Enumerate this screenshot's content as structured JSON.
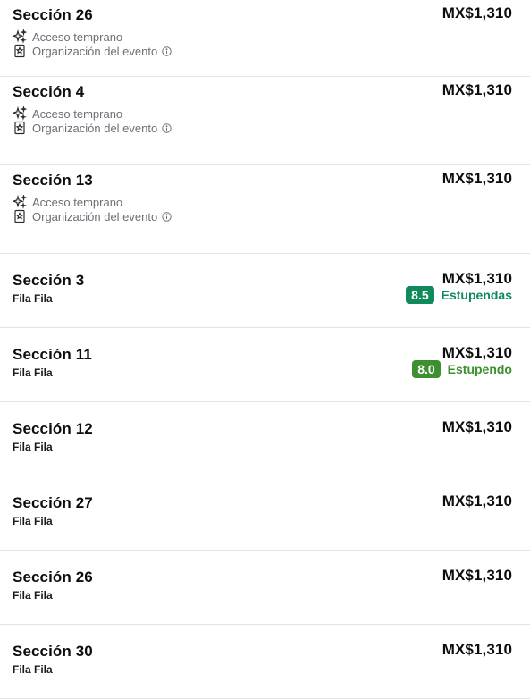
{
  "features": {
    "early_access": "Acceso temprano",
    "event_org": "Organización del evento",
    "early_access_icon": "sparkles-icon",
    "event_org_icon": "ticket-icon",
    "info_icon": "info-icon"
  },
  "colors": {
    "rating_high": "#0e8a5b",
    "rating_mid": "#3d8f2f",
    "divider": "#e4e4e4",
    "muted_text": "#6b6f76"
  },
  "listings": [
    {
      "section": "Sección 26",
      "price": "MX$1,310"
    },
    {
      "section": "Sección 4",
      "price": "MX$1,310"
    },
    {
      "section": "Sección 13",
      "price": "MX$1,310"
    },
    {
      "section": "Sección 3",
      "price": "MX$1,310",
      "row": "Fila Fila",
      "rating": {
        "score": "8.5",
        "label": "Estupendas"
      }
    },
    {
      "section": "Sección 11",
      "price": "MX$1,310",
      "row": "Fila Fila",
      "rating": {
        "score": "8.0",
        "label": "Estupendo"
      }
    },
    {
      "section": "Sección 12",
      "price": "MX$1,310",
      "row": "Fila Fila"
    },
    {
      "section": "Sección 27",
      "price": "MX$1,310",
      "row": "Fila Fila"
    },
    {
      "section": "Sección 26",
      "price": "MX$1,310",
      "row": "Fila Fila"
    },
    {
      "section": "Sección 30",
      "price": "MX$1,310",
      "row": "Fila Fila"
    }
  ]
}
